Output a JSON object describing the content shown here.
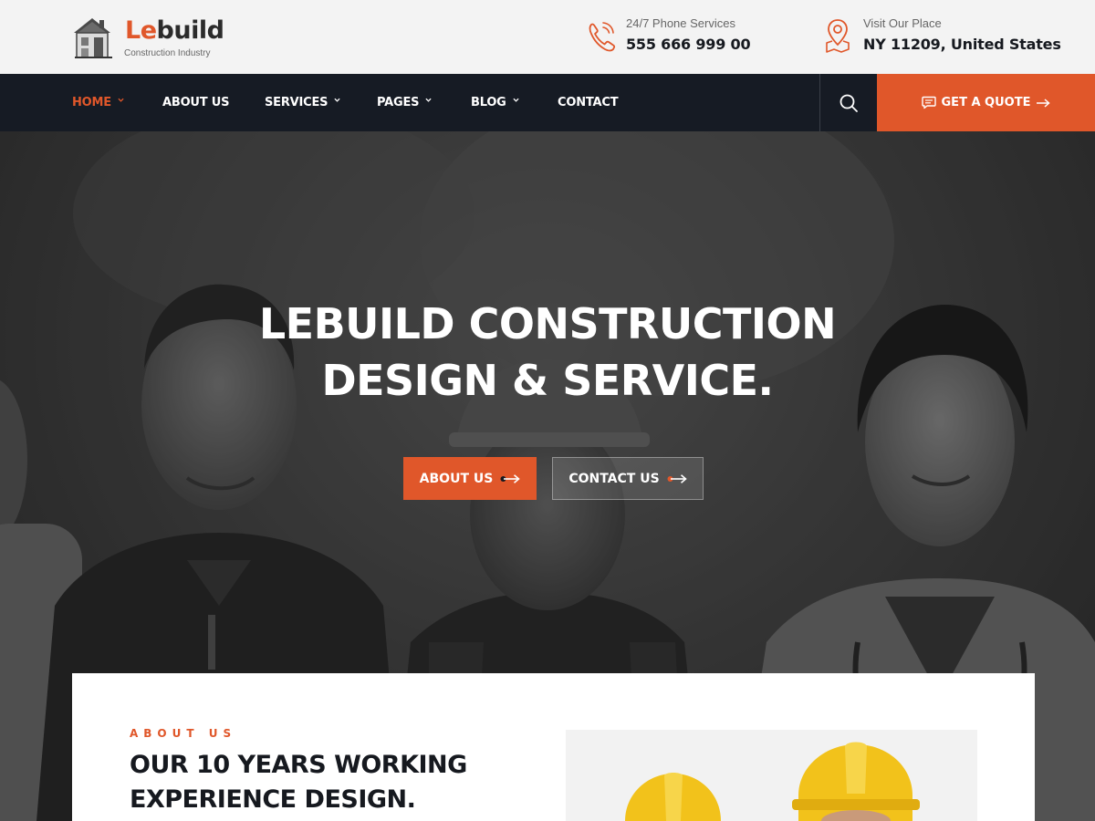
{
  "brand": {
    "name_accent": "Le",
    "name_rest": "build",
    "tagline": "Construction Industry"
  },
  "header": {
    "phone": {
      "label": "24/7 Phone Services",
      "value": "555 666 999 00",
      "icon": "phone-icon"
    },
    "place": {
      "label": "Visit Our Place",
      "value": "NY 11209, United States",
      "icon": "map-pin-icon"
    }
  },
  "nav": {
    "items": [
      {
        "label": "HOME",
        "dropdown": true,
        "active": true
      },
      {
        "label": "ABOUT US",
        "dropdown": false,
        "active": false
      },
      {
        "label": "SERVICES",
        "dropdown": true,
        "active": false
      },
      {
        "label": "PAGES",
        "dropdown": true,
        "active": false
      },
      {
        "label": "BLOG",
        "dropdown": true,
        "active": false
      },
      {
        "label": "CONTACT",
        "dropdown": false,
        "active": false
      }
    ],
    "search_icon": "search-icon",
    "quote_label": "GET A QUOTE"
  },
  "hero": {
    "title_line1": "LEBUILD CONSTRUCTION",
    "title_line2": "DESIGN & SERVICE.",
    "about_button": "ABOUT US",
    "contact_button": "CONTACT US"
  },
  "about": {
    "eyebrow": "ABOUT US",
    "heading_line1": "OUR 10 YEARS WORKING",
    "heading_line2": "EXPERIENCE DESIGN."
  },
  "colors": {
    "accent": "#e0572a",
    "nav_bg": "#161b24",
    "topbar_bg": "#f3f3f3",
    "text_dark": "#16191f"
  }
}
